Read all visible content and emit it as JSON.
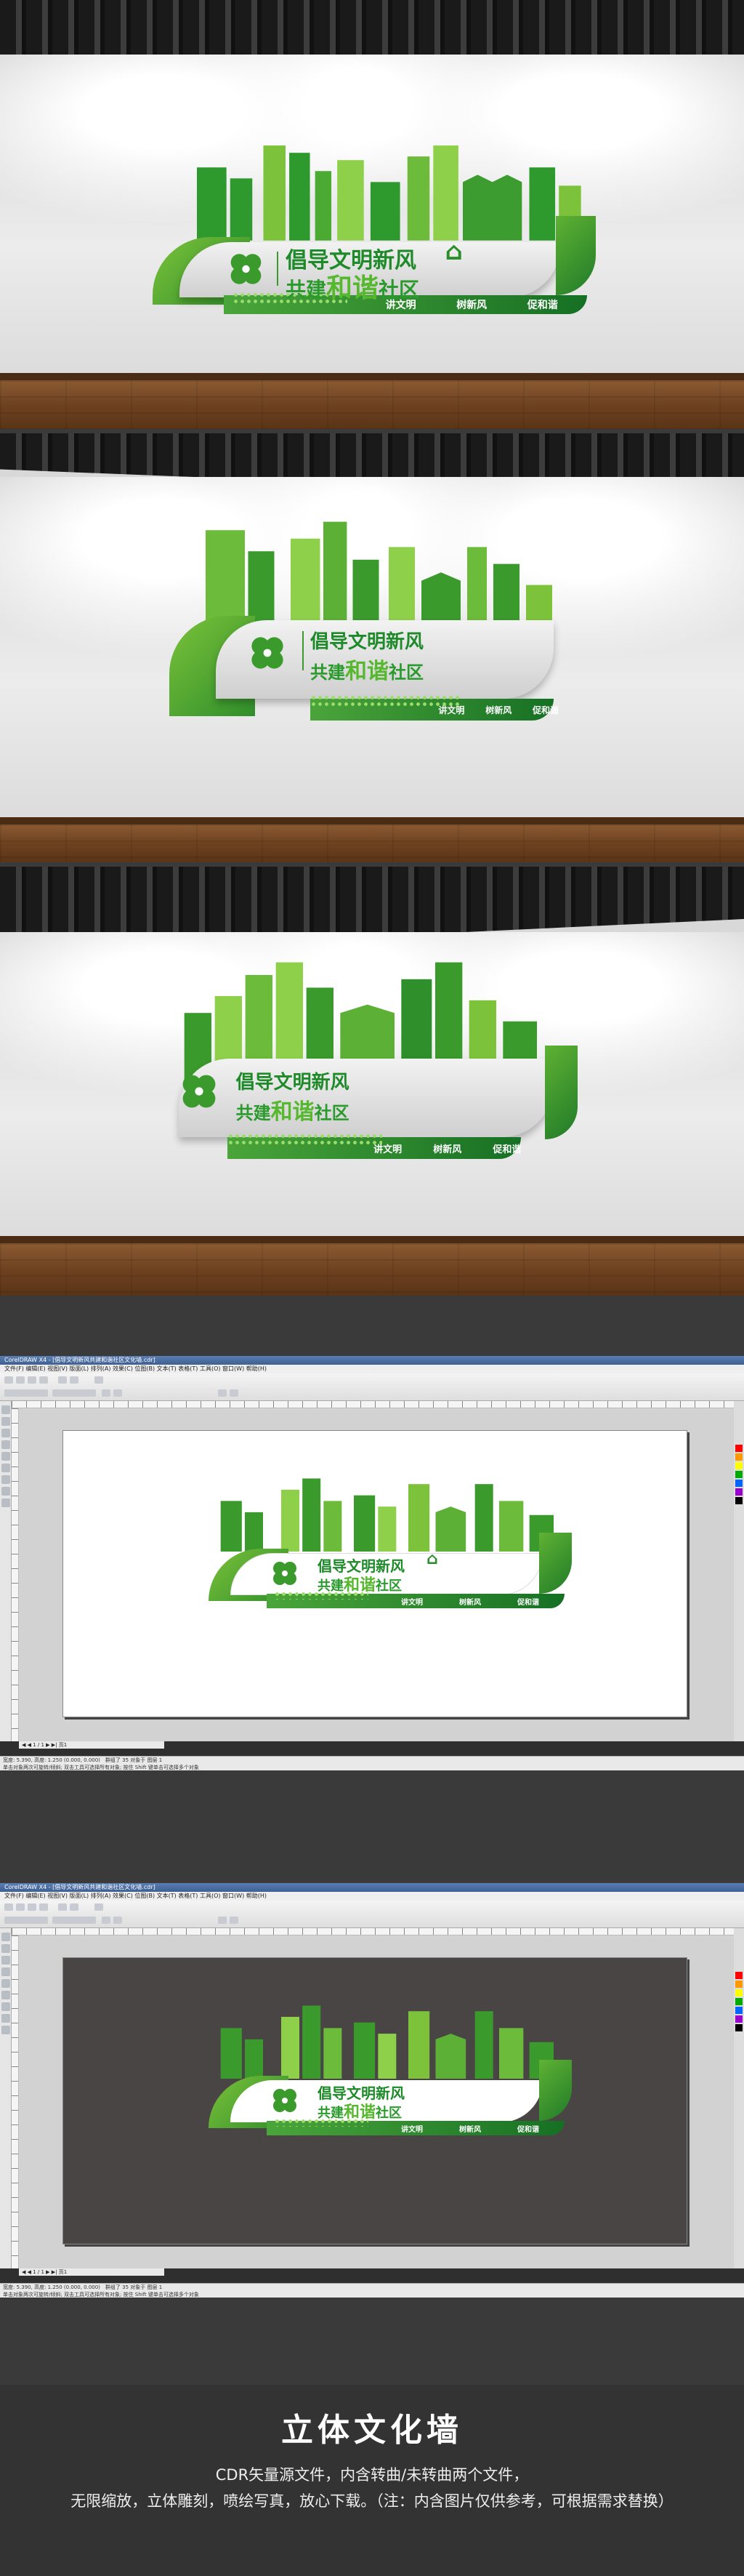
{
  "sign": {
    "title_line1": "倡导文明新风",
    "title_line2_a": "共建",
    "title_line2_big": "和谐",
    "title_line2_b": "社区",
    "slogans": [
      "讲文明",
      "树新风",
      "促和谐"
    ],
    "house_symbol": "⌂"
  },
  "editor": {
    "app_title": "CorelDRAW X4 - [倡导文明新风共建和谐社区文化墙.cdr]",
    "menu": "文件(F)  编辑(E)  视图(V)  版面(L)  排列(A)  效果(C)  位图(B)  文本(T)  表格(T)  工具(O)  窗口(W)  帮助(H)",
    "page_tab": "◀ ◀ 1 / 1 ▶ ▶|  页1",
    "status_left": "宽度: 5.390, 高度: 1.250 (0.000, 0.000)",
    "status_mid": "群组了 35 对象于 图层 1",
    "status_hint": "单击对象两次可旋转/倾斜; 双击工具可选择所有对象; 按住 Shift 键单击可选择多个对象"
  },
  "footer": {
    "title": "立体文化墙",
    "line1": "CDR矢量源文件，内含转曲/未转曲两个文件，",
    "line2": "无限缩放，立体雕刻，喷绘写真，放心下载。（注：内含图片仅供参考，可根据需求替换）"
  },
  "colors": {
    "green_dark": "#1f7a28",
    "green_mid": "#3a9a2c",
    "green_light": "#7cc23a",
    "page_dark": "#4a4545",
    "page_white": "#ffffff",
    "footer_bg": "#333333"
  }
}
